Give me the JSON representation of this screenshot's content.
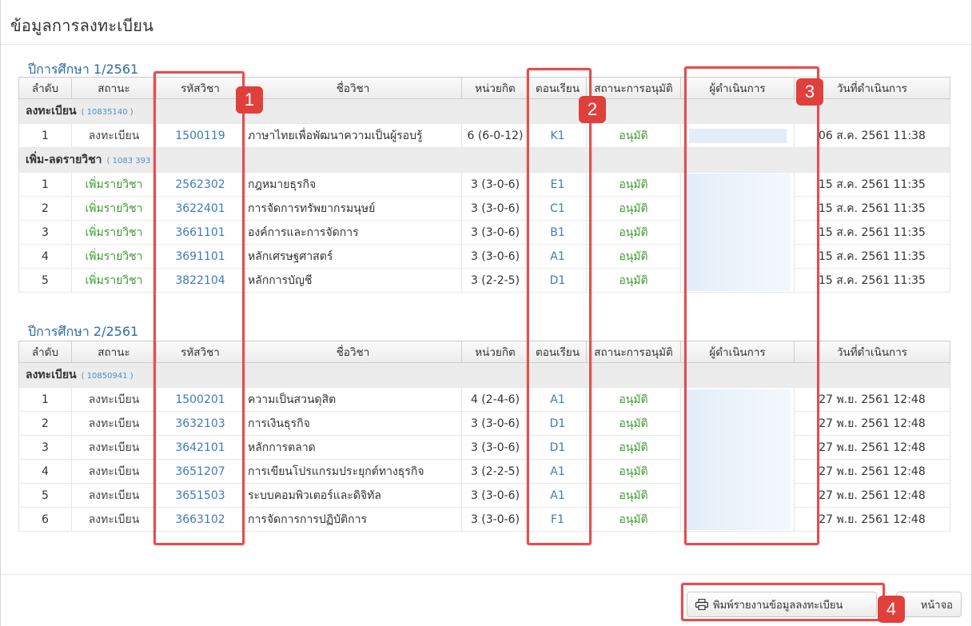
{
  "page": {
    "title": "ข้อมูลการลงทะเบียน"
  },
  "columns": [
    "ลำดับ",
    "สถานะ",
    "รหัสวิชา",
    "ชื่อวิชา",
    "หน่วยกิต",
    "ตอนเรียน",
    "สถานะการอนุมัติ",
    "ผู้ดำเนินการ",
    "วันที่ดำเนินการ"
  ],
  "terms": [
    {
      "label": "ปีการศึกษา 1/2561",
      "groups": [
        {
          "name": "ลงทะเบียน",
          "code": "( 10835140 )",
          "rows": [
            [
              "1",
              "ลงทะเบียน",
              "1500119",
              "ภาษาไทยเพื่อพัฒนาความเป็นผู้รอบรู้",
              "6 (6-0-12)",
              "K1",
              "อนุมัติ",
              "06 ส.ค. 2561 11:38"
            ]
          ]
        },
        {
          "name": "เพิ่ม-ลดรายวิชา",
          "code": "( 1083 393 )",
          "rows": [
            [
              "1",
              "เพิ่มรายวิชา",
              "2562302",
              "กฎหมายธุรกิจ",
              "3 (3-0-6)",
              "E1",
              "อนุมัติ",
              "15 ส.ค. 2561 11:35"
            ],
            [
              "2",
              "เพิ่มรายวิชา",
              "3622401",
              "การจัดการทรัพยากรมนุษย์",
              "3 (3-0-6)",
              "C1",
              "อนุมัติ",
              "15 ส.ค. 2561 11:35"
            ],
            [
              "3",
              "เพิ่มรายวิชา",
              "3661101",
              "องค์การและการจัดการ",
              "3 (3-0-6)",
              "B1",
              "อนุมัติ",
              "15 ส.ค. 2561 11:35"
            ],
            [
              "4",
              "เพิ่มรายวิชา",
              "3691101",
              "หลักเศรษฐศาสตร์",
              "3 (3-0-6)",
              "A1",
              "อนุมัติ",
              "15 ส.ค. 2561 11:35"
            ],
            [
              "5",
              "เพิ่มรายวิชา",
              "3822104",
              "หลักการบัญชี",
              "3 (2-2-5)",
              "D1",
              "อนุมัติ",
              "15 ส.ค. 2561 11:35"
            ]
          ]
        }
      ]
    },
    {
      "label": "ปีการศึกษา 2/2561",
      "groups": [
        {
          "name": "ลงทะเบียน",
          "code": "( 10850941 )",
          "rows": [
            [
              "1",
              "ลงทะเบียน",
              "1500201",
              "ความเป็นสวนดุสิต",
              "4 (2-4-6)",
              "A1",
              "อนุมัติ",
              "27 พ.ย. 2561 12:48"
            ],
            [
              "2",
              "ลงทะเบียน",
              "3632103",
              "การเงินธุรกิจ",
              "3 (3-0-6)",
              "D1",
              "อนุมัติ",
              "27 พ.ย. 2561 12:48"
            ],
            [
              "3",
              "ลงทะเบียน",
              "3642101",
              "หลักการตลาด",
              "3 (3-0-6)",
              "D1",
              "อนุมัติ",
              "27 พ.ย. 2561 12:48"
            ],
            [
              "4",
              "ลงทะเบียน",
              "3651207",
              "การเขียนโปรแกรมประยุกต์ทางธุรกิจ",
              "3 (2-2-5)",
              "A1",
              "อนุมัติ",
              "27 พ.ย. 2561 12:48"
            ],
            [
              "5",
              "ลงทะเบียน",
              "3651503",
              "ระบบคอมพิวเตอร์และดิจิทัล",
              "3 (3-0-6)",
              "A1",
              "อนุมัติ",
              "27 พ.ย. 2561 12:48"
            ],
            [
              "6",
              "ลงทะเบียน",
              "3663102",
              "การจัดการการปฏิบัติการ",
              "3 (3-0-6)",
              "F1",
              "อนุมัติ",
              "27 พ.ย. 2561 12:48"
            ]
          ]
        }
      ]
    }
  ],
  "annotations": [
    "1",
    "2",
    "3",
    "4"
  ],
  "buttons": {
    "print_label": "พิมพ์รายงานข้อมูลลงทะเบียน",
    "close_label": "หน้าจอ",
    "print_icon": "printer-icon"
  },
  "colors": {
    "link_blue": "#3a7bc0",
    "approved_green": "#3c9a2e",
    "annotation_red": "#e05050",
    "term_blue": "#2e6da4"
  }
}
